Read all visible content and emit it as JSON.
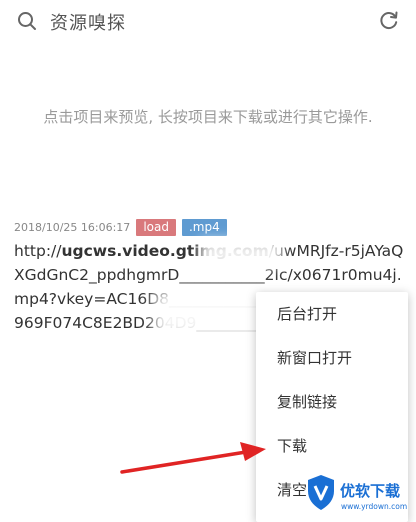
{
  "header": {
    "title": "资源嗅探",
    "search_icon": "search-icon",
    "refresh_icon": "refresh-icon"
  },
  "hint": "点击项目来预览, 长按项目来下载或进行其它操作.",
  "item": {
    "date": "2018/10/25 16:06:17",
    "tag_load": "load",
    "tag_ext": ".mp4",
    "url_prefix": "http://",
    "url_host": "ugcws.video.gtimg.com",
    "url_rest": "/uwMRJfz-r5jAYaQXGdGnC2_ppdhgmrD___________2Ic/x0671r0mu4j.mp4?vkey=AC16D8______________E248A3A6C9F7969F074C8E2BD204D9___________________15"
  },
  "context_menu": {
    "items": [
      "后台打开",
      "新窗口打开",
      "复制链接",
      "下载",
      "清空"
    ]
  },
  "colors": {
    "tag_load": "#d9797c",
    "tag_ext": "#5f9bd1",
    "arrow": "#e02424",
    "watermark": "#1a6fd4"
  },
  "watermark": {
    "brand": "优软下载",
    "site": "www.yrdown.com"
  }
}
